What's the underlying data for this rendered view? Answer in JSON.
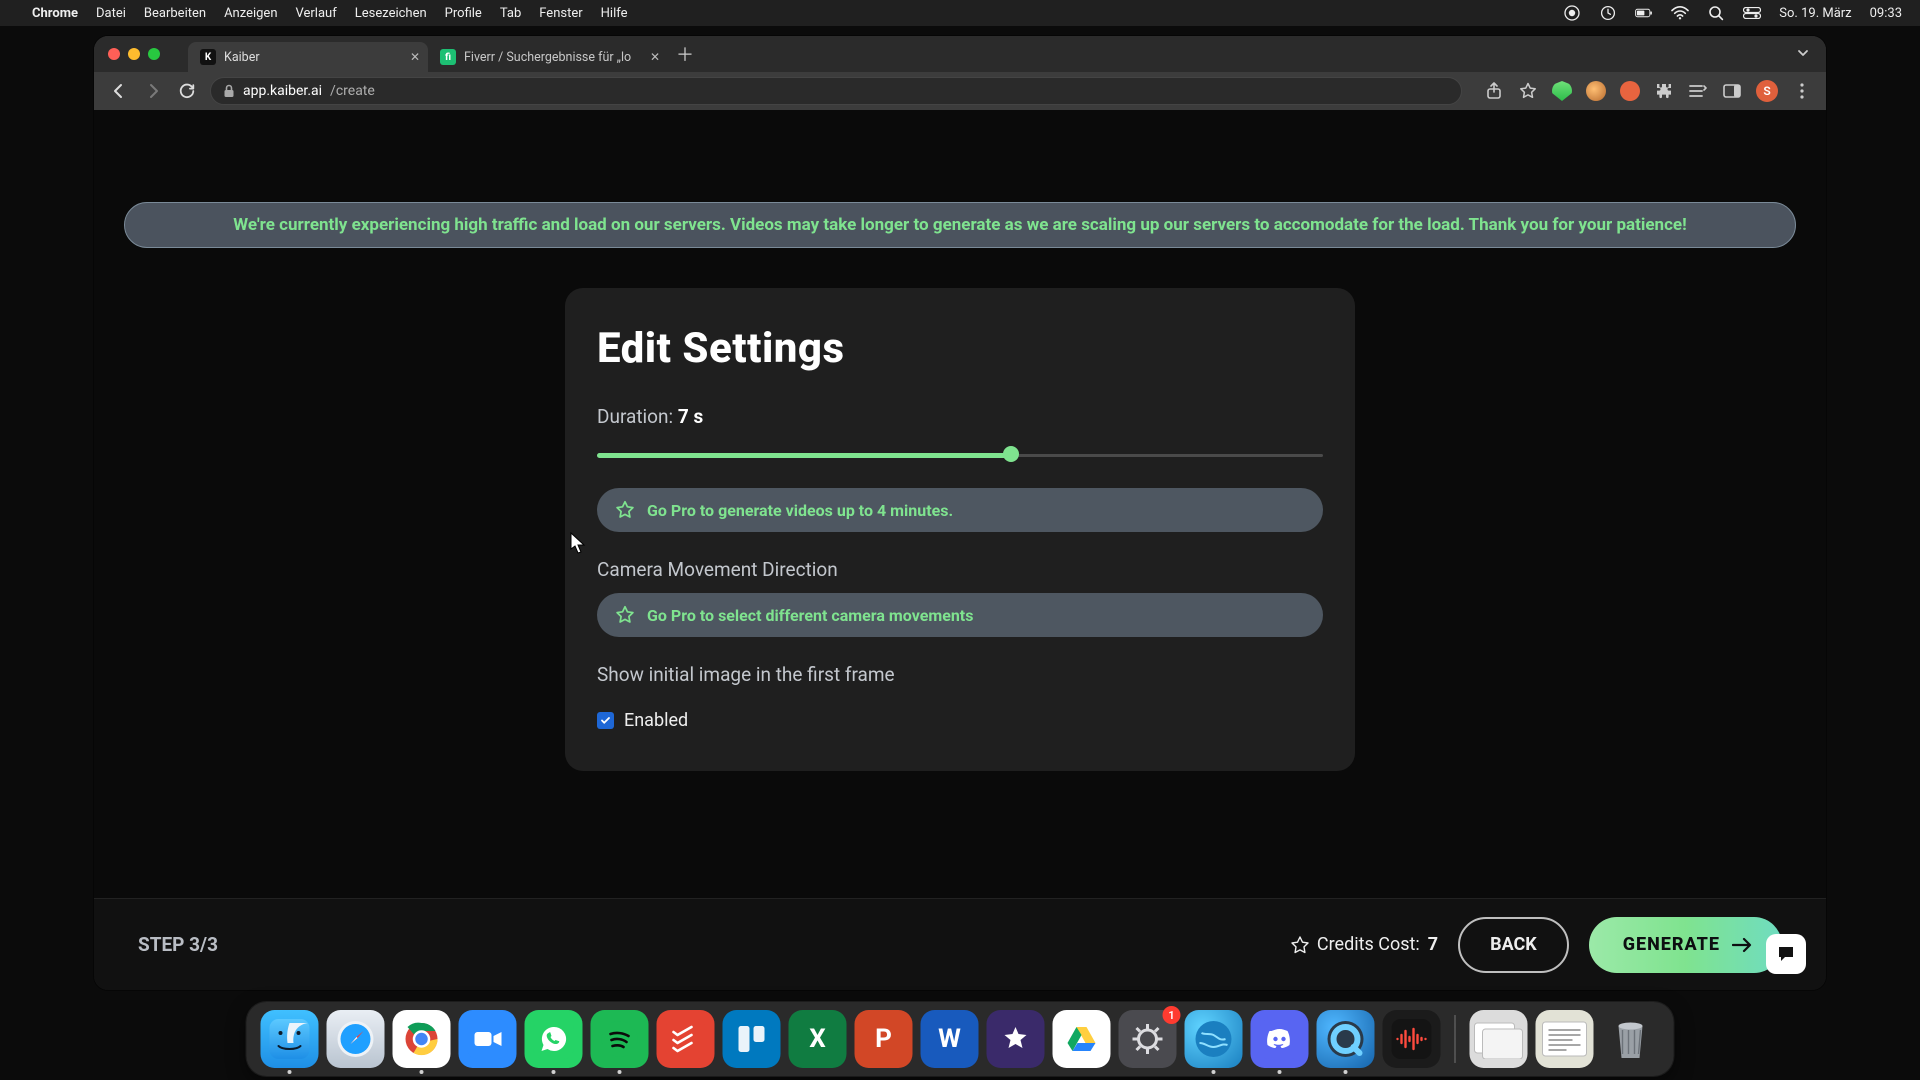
{
  "os": {
    "app_name": "Chrome",
    "menu": [
      "Datei",
      "Bearbeiten",
      "Anzeigen",
      "Verlauf",
      "Lesezeichen",
      "Profile",
      "Tab",
      "Fenster",
      "Hilfe"
    ],
    "date": "So. 19. März",
    "time": "09:33"
  },
  "browser": {
    "tabs": [
      {
        "title": "Kaiber",
        "favicon_letter": "K",
        "favicon_bg": "#111",
        "favicon_fg": "#fff",
        "active": true
      },
      {
        "title": "Fiverr / Suchergebnisse für „lo",
        "favicon_letter": "fi",
        "favicon_bg": "#1dbf73",
        "favicon_fg": "#fff",
        "active": false
      }
    ],
    "url_host": "app.kaiber.ai",
    "url_path": "/create",
    "avatar_letter": "S"
  },
  "notice": "We're currently experiencing high traffic and load on our servers. Videos may take longer to generate as we are scaling up our servers to accomodate for the load. Thank you for your patience!",
  "settings": {
    "heading": "Edit Settings",
    "duration_label": "Duration: ",
    "duration_value": "7 s",
    "duration_ratio": 0.57,
    "pro_duration": "Go Pro to generate videos up to 4 minutes.",
    "camera_label": "Camera Movement Direction",
    "pro_camera": "Go Pro to select different camera movements",
    "show_initial_label": "Show initial image in the first frame",
    "enabled_label": "Enabled",
    "enabled_checked": true
  },
  "footer": {
    "step": "STEP 3/3",
    "credits_label": "Credits Cost: ",
    "credits_value": "7",
    "back": "BACK",
    "generate": "GENERATE"
  },
  "dock": {
    "settings_badge": "1",
    "apps_left": [
      {
        "name": "finder",
        "cls": "bg-finder",
        "glyph": "",
        "running": true
      },
      {
        "name": "safari",
        "cls": "bg-safari",
        "glyph": "",
        "running": false
      },
      {
        "name": "chrome",
        "cls": "bg-chrome",
        "glyph": "",
        "running": true
      },
      {
        "name": "zoom",
        "cls": "bg-zoom",
        "glyph": "",
        "running": false
      },
      {
        "name": "whatsapp",
        "cls": "bg-whatsapp",
        "glyph": "",
        "running": true
      },
      {
        "name": "spotify",
        "cls": "bg-spotify",
        "glyph": "",
        "running": true
      },
      {
        "name": "todoist",
        "cls": "bg-todoist",
        "glyph": "",
        "running": false
      },
      {
        "name": "trello",
        "cls": "bg-trello",
        "glyph": "",
        "running": false
      },
      {
        "name": "excel",
        "cls": "bg-excel",
        "glyph": "X",
        "running": false
      },
      {
        "name": "powerpoint",
        "cls": "bg-ppt",
        "glyph": "P",
        "running": false
      },
      {
        "name": "word",
        "cls": "bg-word",
        "glyph": "W",
        "running": false
      },
      {
        "name": "imovie",
        "cls": "bg-imovie",
        "glyph": "★",
        "running": false
      },
      {
        "name": "google-drive",
        "cls": "bg-drive",
        "glyph": "",
        "running": false
      },
      {
        "name": "system-settings",
        "cls": "bg-settings",
        "glyph": "",
        "running": false,
        "badge": "1"
      },
      {
        "name": "earth",
        "cls": "bg-globe",
        "glyph": "",
        "running": true
      },
      {
        "name": "discord",
        "cls": "bg-discord",
        "glyph": "",
        "running": true
      },
      {
        "name": "quicktime",
        "cls": "bg-qt",
        "glyph": "",
        "running": true
      },
      {
        "name": "audio-app",
        "cls": "bg-audio",
        "glyph": "",
        "running": false
      }
    ],
    "apps_right": [
      {
        "name": "preview-doc",
        "cls": "bg-preview",
        "glyph": "",
        "running": false
      },
      {
        "name": "text-doc",
        "cls": "bg-notes",
        "glyph": "",
        "running": false
      },
      {
        "name": "trash",
        "cls": "bg-trash",
        "glyph": "",
        "running": false
      }
    ]
  }
}
